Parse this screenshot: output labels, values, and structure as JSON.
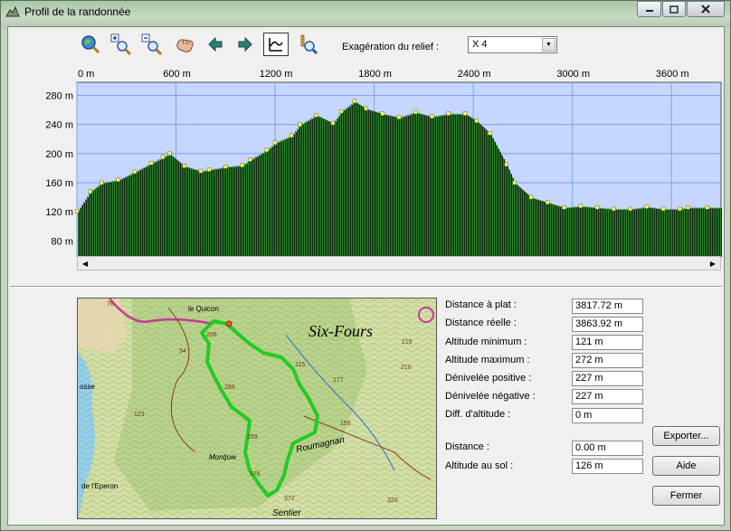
{
  "window": {
    "title": "Profil de la randonnée",
    "min_icon": "minimize-icon",
    "max_icon": "maximize-icon",
    "close_icon": "close-icon"
  },
  "toolbar": {
    "tools": [
      "zoom-all-icon",
      "zoom-in-icon",
      "zoom-out-icon",
      "pan-hand-icon",
      "arrow-left-icon",
      "arrow-right-icon",
      "profile-cursor-icon",
      "locate-icon"
    ],
    "relief_label": "Exagération du relief :",
    "relief_value": "X 4"
  },
  "chart_data": {
    "type": "area",
    "x_unit": "m",
    "x_tick_labels": [
      "0 m",
      "600 m",
      "1200 m",
      "1800 m",
      "2400 m",
      "3000 m",
      "3600 m"
    ],
    "x_ticks": [
      0,
      600,
      1200,
      1800,
      2400,
      3000,
      3600
    ],
    "y_tick_labels": [
      "80 m",
      "120 m",
      "160 m",
      "200 m",
      "240 m",
      "280 m"
    ],
    "y_ticks": [
      80,
      120,
      160,
      200,
      240,
      280
    ],
    "ylim": [
      58,
      298
    ],
    "grid": true,
    "colors": {
      "sky": "#c5d7ff",
      "ground": "#2d8c2d",
      "point": "#fff86b",
      "grid": "#7f9fe8"
    },
    "series": [
      {
        "x": [
          0,
          80,
          150,
          250,
          350,
          450,
          520,
          560,
          650,
          750,
          800,
          900,
          1000,
          1050,
          1150,
          1200,
          1300,
          1350,
          1450,
          1550,
          1600,
          1680,
          1750,
          1850,
          1950,
          2050,
          2150,
          2250,
          2350,
          2420,
          2500,
          2600,
          2650,
          2750,
          2850,
          2950,
          3050,
          3150,
          3250,
          3350,
          3450,
          3550,
          3650,
          3700,
          3817
        ],
        "y": [
          121,
          148,
          160,
          164,
          175,
          187,
          195,
          200,
          183,
          176,
          178,
          182,
          184,
          192,
          205,
          215,
          225,
          240,
          253,
          242,
          258,
          272,
          262,
          255,
          250,
          257,
          251,
          255,
          255,
          245,
          228,
          185,
          160,
          140,
          133,
          126,
          128,
          126,
          124,
          124,
          127,
          124,
          124,
          126,
          126
        ]
      }
    ]
  },
  "stats": [
    {
      "label": "Distance à plat :",
      "value": "3817.72 m"
    },
    {
      "label": "Distance réelle :",
      "value": "3863.92 m"
    },
    {
      "label": "Altitude minimum :",
      "value": "121 m"
    },
    {
      "label": "Altitude maximum :",
      "value": "272 m"
    },
    {
      "label": "Dénivelée positive :",
      "value": "227 m"
    },
    {
      "label": "Dénivelée négative :",
      "value": "227 m"
    },
    {
      "label": "Diff. d'altitude :",
      "value": "0 m"
    }
  ],
  "cursor": [
    {
      "label": "Distance :",
      "value": "0.00 m"
    },
    {
      "label": "Altitude au sol :",
      "value": "126 m"
    }
  ],
  "buttons": {
    "export": "Exporter...",
    "help": "Aide",
    "close": "Fermer"
  },
  "map": {
    "town": "Six-Fours",
    "places": [
      "le Quicon",
      "Montjoie",
      "Roumagnan",
      "de l'Eperon",
      "Sentier",
      "osse"
    ],
    "spot_heights": [
      "76",
      "206",
      "115",
      "177",
      "289",
      "216",
      "123",
      "159",
      "259",
      "276",
      "372",
      "320",
      "210",
      "34"
    ],
    "route_color": "#22cc22"
  }
}
